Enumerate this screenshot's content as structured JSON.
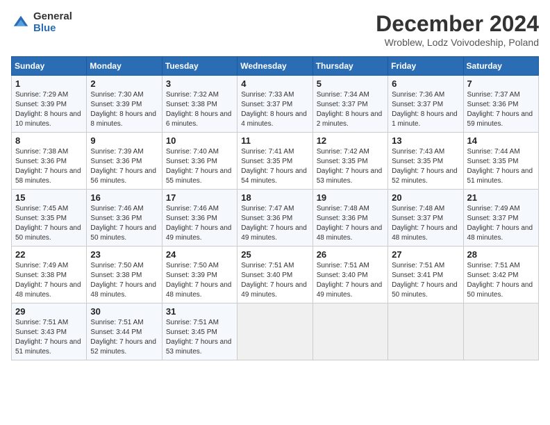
{
  "logo": {
    "general": "General",
    "blue": "Blue"
  },
  "title": "December 2024",
  "subtitle": "Wroblew, Lodz Voivodeship, Poland",
  "days_of_week": [
    "Sunday",
    "Monday",
    "Tuesday",
    "Wednesday",
    "Thursday",
    "Friday",
    "Saturday"
  ],
  "weeks": [
    [
      {
        "day": 1,
        "sunrise": "7:29 AM",
        "sunset": "3:39 PM",
        "daylight": "8 hours and 10 minutes."
      },
      {
        "day": 2,
        "sunrise": "7:30 AM",
        "sunset": "3:39 PM",
        "daylight": "8 hours and 8 minutes."
      },
      {
        "day": 3,
        "sunrise": "7:32 AM",
        "sunset": "3:38 PM",
        "daylight": "8 hours and 6 minutes."
      },
      {
        "day": 4,
        "sunrise": "7:33 AM",
        "sunset": "3:37 PM",
        "daylight": "8 hours and 4 minutes."
      },
      {
        "day": 5,
        "sunrise": "7:34 AM",
        "sunset": "3:37 PM",
        "daylight": "8 hours and 2 minutes."
      },
      {
        "day": 6,
        "sunrise": "7:36 AM",
        "sunset": "3:37 PM",
        "daylight": "8 hours and 1 minute."
      },
      {
        "day": 7,
        "sunrise": "7:37 AM",
        "sunset": "3:36 PM",
        "daylight": "7 hours and 59 minutes."
      }
    ],
    [
      {
        "day": 8,
        "sunrise": "7:38 AM",
        "sunset": "3:36 PM",
        "daylight": "7 hours and 58 minutes."
      },
      {
        "day": 9,
        "sunrise": "7:39 AM",
        "sunset": "3:36 PM",
        "daylight": "7 hours and 56 minutes."
      },
      {
        "day": 10,
        "sunrise": "7:40 AM",
        "sunset": "3:36 PM",
        "daylight": "7 hours and 55 minutes."
      },
      {
        "day": 11,
        "sunrise": "7:41 AM",
        "sunset": "3:35 PM",
        "daylight": "7 hours and 54 minutes."
      },
      {
        "day": 12,
        "sunrise": "7:42 AM",
        "sunset": "3:35 PM",
        "daylight": "7 hours and 53 minutes."
      },
      {
        "day": 13,
        "sunrise": "7:43 AM",
        "sunset": "3:35 PM",
        "daylight": "7 hours and 52 minutes."
      },
      {
        "day": 14,
        "sunrise": "7:44 AM",
        "sunset": "3:35 PM",
        "daylight": "7 hours and 51 minutes."
      }
    ],
    [
      {
        "day": 15,
        "sunrise": "7:45 AM",
        "sunset": "3:35 PM",
        "daylight": "7 hours and 50 minutes."
      },
      {
        "day": 16,
        "sunrise": "7:46 AM",
        "sunset": "3:36 PM",
        "daylight": "7 hours and 50 minutes."
      },
      {
        "day": 17,
        "sunrise": "7:46 AM",
        "sunset": "3:36 PM",
        "daylight": "7 hours and 49 minutes."
      },
      {
        "day": 18,
        "sunrise": "7:47 AM",
        "sunset": "3:36 PM",
        "daylight": "7 hours and 49 minutes."
      },
      {
        "day": 19,
        "sunrise": "7:48 AM",
        "sunset": "3:36 PM",
        "daylight": "7 hours and 48 minutes."
      },
      {
        "day": 20,
        "sunrise": "7:48 AM",
        "sunset": "3:37 PM",
        "daylight": "7 hours and 48 minutes."
      },
      {
        "day": 21,
        "sunrise": "7:49 AM",
        "sunset": "3:37 PM",
        "daylight": "7 hours and 48 minutes."
      }
    ],
    [
      {
        "day": 22,
        "sunrise": "7:49 AM",
        "sunset": "3:38 PM",
        "daylight": "7 hours and 48 minutes."
      },
      {
        "day": 23,
        "sunrise": "7:50 AM",
        "sunset": "3:38 PM",
        "daylight": "7 hours and 48 minutes."
      },
      {
        "day": 24,
        "sunrise": "7:50 AM",
        "sunset": "3:39 PM",
        "daylight": "7 hours and 48 minutes."
      },
      {
        "day": 25,
        "sunrise": "7:51 AM",
        "sunset": "3:40 PM",
        "daylight": "7 hours and 49 minutes."
      },
      {
        "day": 26,
        "sunrise": "7:51 AM",
        "sunset": "3:40 PM",
        "daylight": "7 hours and 49 minutes."
      },
      {
        "day": 27,
        "sunrise": "7:51 AM",
        "sunset": "3:41 PM",
        "daylight": "7 hours and 50 minutes."
      },
      {
        "day": 28,
        "sunrise": "7:51 AM",
        "sunset": "3:42 PM",
        "daylight": "7 hours and 50 minutes."
      }
    ],
    [
      {
        "day": 29,
        "sunrise": "7:51 AM",
        "sunset": "3:43 PM",
        "daylight": "7 hours and 51 minutes."
      },
      {
        "day": 30,
        "sunrise": "7:51 AM",
        "sunset": "3:44 PM",
        "daylight": "7 hours and 52 minutes."
      },
      {
        "day": 31,
        "sunrise": "7:51 AM",
        "sunset": "3:45 PM",
        "daylight": "7 hours and 53 minutes."
      },
      null,
      null,
      null,
      null
    ]
  ]
}
